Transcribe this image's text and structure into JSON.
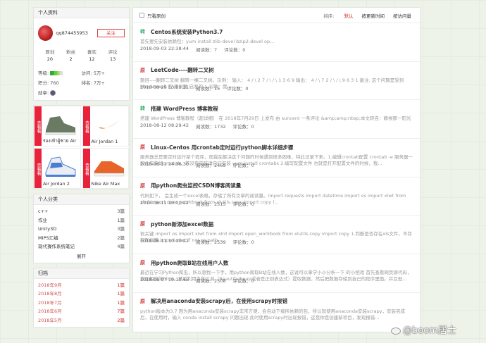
{
  "profile": {
    "header": "个人资料",
    "username": "qq874455953",
    "follow_label": "关注",
    "stats": [
      {
        "label": "原创",
        "value": "20"
      },
      {
        "label": "粉丝",
        "value": "2"
      },
      {
        "label": "喜欢",
        "value": "12"
      },
      {
        "label": "评论",
        "value": "13"
      }
    ],
    "level_label": "等级:",
    "visits_label": "访问:",
    "visits_value": "5万+",
    "points_label": "积分:",
    "points_value": "760",
    "rank_label": "排名:",
    "rank_value": "7万+",
    "medal_label": "勋章:"
  },
  "ads": [
    {
      "tag": "去看看",
      "caption": "รองเท้าผู้ชาย Air",
      "color": "#6b7a63"
    },
    {
      "tag": "去看看",
      "caption": "Air Jordan 1",
      "color": "#f07a2a"
    },
    {
      "tag": "去看看",
      "caption": "Air Jordan 2",
      "color": "#4a7ed1"
    },
    {
      "tag": "去看看",
      "caption": "Nike Air Max",
      "color": "#e8642a"
    }
  ],
  "categories": {
    "header": "个人分类",
    "items": [
      {
        "name": "c++",
        "count": "3篇"
      },
      {
        "name": "作业",
        "count": "1篇"
      },
      {
        "name": "Unity3D",
        "count": "3篇"
      },
      {
        "name": "MIPS汇编",
        "count": "2篇"
      },
      {
        "name": "现代操作系统笔记",
        "count": "4篇"
      }
    ],
    "expand_label": "展开"
  },
  "archive": {
    "header": "归档",
    "items": [
      {
        "name": "2018年9月",
        "count": "1篇"
      },
      {
        "name": "2018年8月",
        "count": "1篇"
      },
      {
        "name": "2018年7月",
        "count": "1篇"
      },
      {
        "name": "2018年6月",
        "count": "7篇"
      },
      {
        "name": "2018年5月",
        "count": "2篇"
      }
    ]
  },
  "toolbar": {
    "only_original_label": "只看原创",
    "sort_label": "排序:",
    "sort_options": [
      "默认",
      "按更新时间",
      "按访问量"
    ]
  },
  "articles": [
    {
      "badge": "转",
      "badge_type": "y",
      "title": "Centos系统安装Python3.7",
      "desc": "首先要先安装依赖包：yum install zlib-devel bzip2-devel op...",
      "date": "2018-09-03 22:38:44",
      "reads": "阅读数：7",
      "comments": "评论数：0"
    },
    {
      "badge": "原",
      "badge_type": "o",
      "title": "LeetCode----翻转二叉树",
      "desc": "题目----翻转二叉树 翻转一棵二叉树。示例：   输入：  4 / \\ 2 7 / \\ / \\ 1 3 6 9 输出：  4 / \\ 7 2 / \\ / \\ 9 6 3 1 备注: 这个问题是受到 Max Howell 的 原问题 启发的 ：谷歌：我...",
      "date": "2018-08-29 10:00:31",
      "reads": "阅读数：15",
      "comments": "评论数：0"
    },
    {
      "badge": "转",
      "badge_type": "y",
      "title": "搭建 WordPress 博客教程",
      "desc": "搭建 WordPress 博客教程（超详细） 在 2018年7月29日 上发布 由 suncent 一条评论 &amp;amp;nbsp;本文转自：静候那一阳光",
      "date": "2018-08-12 08:29:42",
      "reads": "阅读数：1732",
      "comments": "评论数：0"
    },
    {
      "badge": "原",
      "badge_type": "o",
      "title": "Linux-Centos 用crontab定时运行python脚本详细步骤",
      "desc": "服务器总是要定时运行某个程序，而我在解决这个问题的时候遇到很多困难，特此记录下来。1.编辑crontab配置 crontab -e 服务器一般会安装好crontab，若没有安装请自行安装 yum install crontabs 2.编写配置文件 也就是打开配置文件的时候，我...",
      "date": "2018-06-11 14:36:30",
      "reads": "阅读数：2469",
      "comments": "评论数：0"
    },
    {
      "badge": "原",
      "badge_type": "o",
      "title": "用python爬虫监控CSDN博客阅读量",
      "desc": "代码如下，  会生成一个excel表格，存储了所有文章的阅读量。import requests import datetime import os import xlwt from xlrd import open_workbook from xlutils.copy import copy l...",
      "date": "2018-06-11 10:00:22",
      "reads": "阅读数：2515",
      "comments": "评论数：0"
    },
    {
      "badge": "原",
      "badge_type": "o",
      "title": "python新添加excel数据",
      "desc": "很关键 import os import xlwt from xlrd import open_workbook from xlutils.copy import copy 1.判断是否存在xls文件，不存在则创建 import xlwt if not os.path...",
      "date": "2018-06-11 10:00:22",
      "reads": "阅读数：2539",
      "comments": "评论数：0"
    },
    {
      "badge": "原",
      "badge_type": "o",
      "title": "用python爬取B站在线用户人数",
      "desc": "最近在学习Python爬虫，所以想找一下手，用python爬取B站在线人数，这说可以拿学小小分析一下 的小把戏 首先查看网页源代码，找到相应的html，然后利用各种工具（BeautifulSoup或者是正则表达式）提取数据，然后把数据存储到自己的程序里面。并且但...",
      "date": "2018-06-07 19:10:45",
      "reads": "阅读数：2508",
      "comments": "评论数：0"
    },
    {
      "badge": "原",
      "badge_type": "o",
      "title": "解决用anaconda安装scrapy后，在使用scrapy时报错",
      "desc": "python版本为3.7 因为用anaconda安装scrapy非常方便，会自动下载所依赖的包，所以就使用anaconda安装scrapy，安装完成后，在使用时，输入 conda install scrapy 问题出现 此时使用scrapy时出现报错，这是你是创建新项目，发现报错...",
      "date": "",
      "reads": "",
      "comments": ""
    }
  ],
  "watermark": "@boom居士"
}
